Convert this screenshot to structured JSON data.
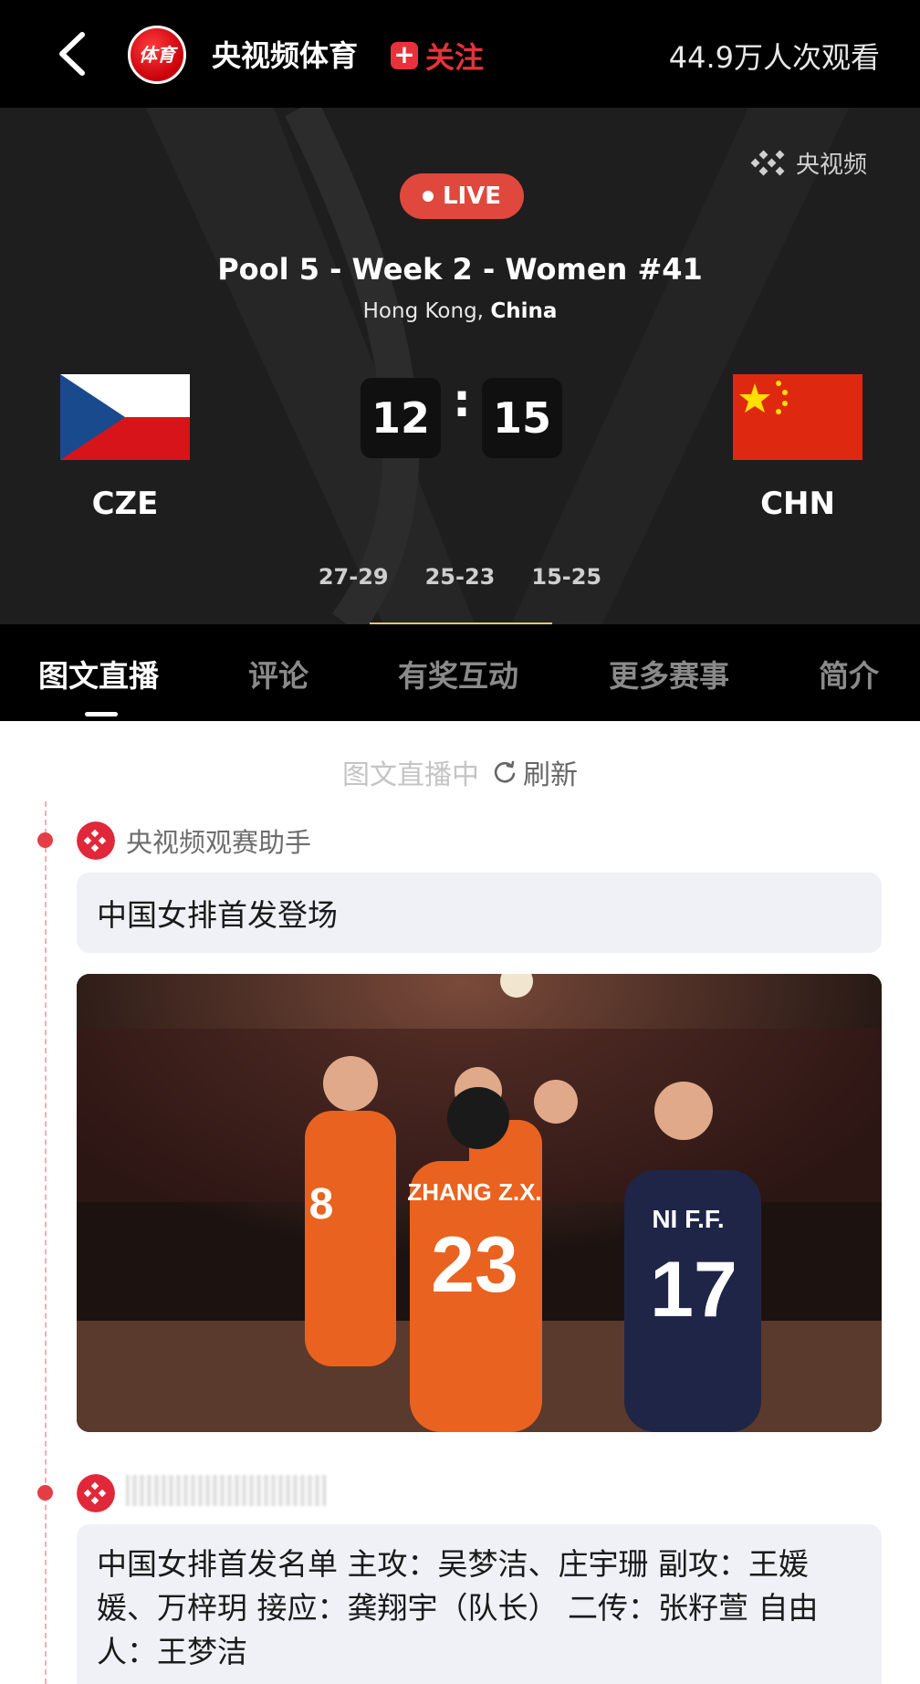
{
  "header": {
    "channel_logo_text": "体育",
    "channel_name": "央视频体育",
    "follow_label": "关注",
    "view_count": "44.9万人次观看"
  },
  "scoreboard": {
    "watermark": "央视频",
    "live_label": "LIVE",
    "match_title": "Pool 5 - Week 2 - Women #41",
    "venue_city": "Hong Kong, ",
    "venue_country": "China",
    "home": {
      "code": "CZE",
      "score": "12"
    },
    "away": {
      "code": "CHN",
      "score": "15"
    },
    "separator": ":",
    "sets": [
      "27-29",
      "25-23",
      "15-25"
    ],
    "colors": {
      "accent": "#e0483d",
      "background": "#1e1e1e",
      "cze_blue": "#1a4a8e",
      "cze_red": "#d7141a",
      "chn_red": "#de2910",
      "chn_star": "#ffde00"
    }
  },
  "tabs": [
    "图文直播",
    "评论",
    "有奖互动",
    "更多赛事",
    "简介"
  ],
  "feed": {
    "status_label": "图文直播中",
    "refresh_label": "刷新",
    "posts": [
      {
        "author": "央视频观赛助手",
        "text": "中国女排首发登场"
      },
      {
        "author": "",
        "text": "中国女排首发名单 主攻：吴梦洁、庄宇珊 副攻：王媛媛、万梓玥 接应：龚翔宇（队长） 二传：张籽萱 自由人：王梦洁"
      }
    ],
    "image_jerseys": [
      {
        "name": "ZHANG Z.X.",
        "number": "23"
      },
      {
        "name": "NI F.F.",
        "number": "17"
      },
      {
        "number": "8"
      }
    ]
  }
}
